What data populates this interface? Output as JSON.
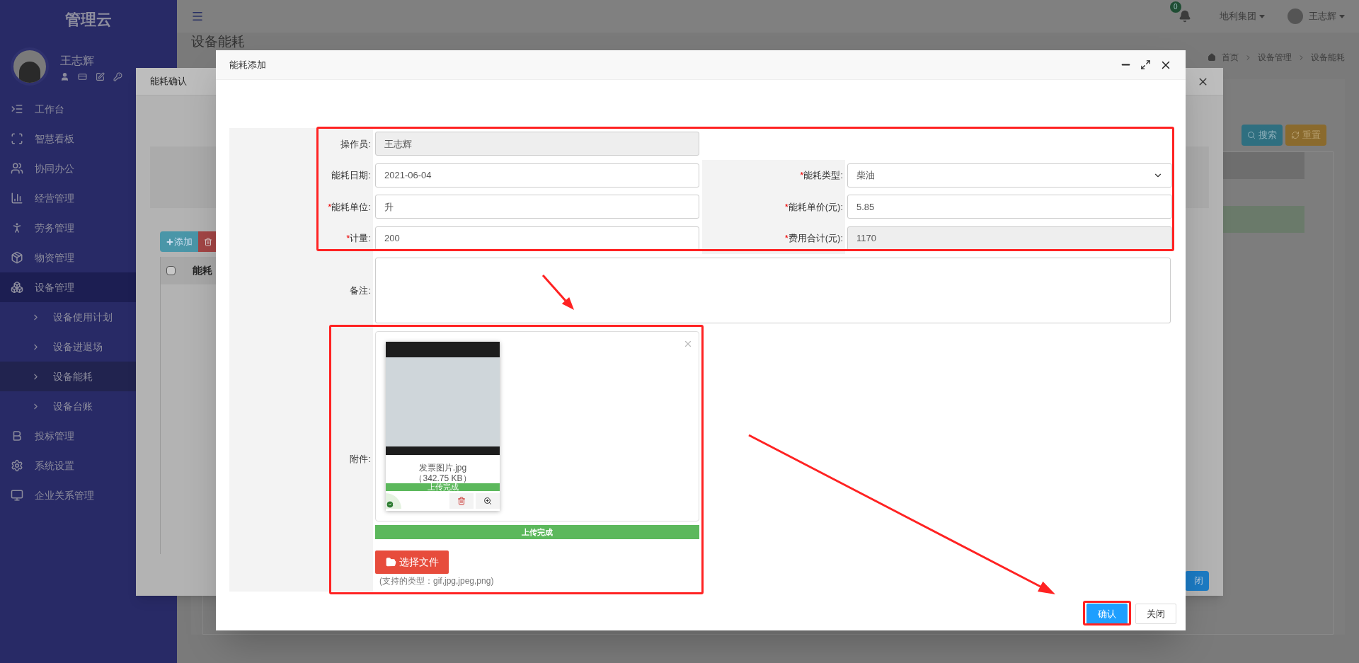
{
  "sidebar": {
    "title": "管理云",
    "user": "王志辉",
    "items": [
      {
        "label": "工作台"
      },
      {
        "label": "智慧看板"
      },
      {
        "label": "协同办公"
      },
      {
        "label": "经营管理"
      },
      {
        "label": "劳务管理"
      },
      {
        "label": "物资管理"
      },
      {
        "label": "设备管理",
        "expanded": true,
        "children": [
          {
            "label": "设备使用计划",
            "selected": false
          },
          {
            "label": "设备进退场",
            "selected": false
          },
          {
            "label": "设备能耗",
            "selected": true
          },
          {
            "label": "设备台账",
            "selected": false
          }
        ]
      },
      {
        "label": "投标管理"
      },
      {
        "label": "系统设置"
      },
      {
        "label": "企业关系管理"
      }
    ]
  },
  "top_bar": {
    "notification_count": "0",
    "organization": "地利集团",
    "user": "王志辉"
  },
  "page": {
    "title": "设备能耗",
    "breadcrumb": [
      "首页",
      "设备管理",
      "设备能耗"
    ],
    "search_button": "搜索",
    "reset_button": "重置"
  },
  "background_dialog": {
    "title": "能耗确认",
    "add_button": "添加",
    "table_header": "能耗",
    "select_all_checked": false,
    "footer_button": "闭"
  },
  "dialog": {
    "title": "能耗添加",
    "rows": [
      [
        {
          "label": "操作员:",
          "value": "王志辉",
          "readonly": true,
          "kind": "text"
        }
      ],
      [
        {
          "label": "能耗日期:",
          "value": "2021-06-04",
          "readonly": false,
          "kind": "text"
        },
        {
          "label": "能耗类型:",
          "required_mark": "*",
          "value": "柴油",
          "readonly": false,
          "kind": "select"
        }
      ],
      [
        {
          "label": "能耗单位:",
          "required_mark": "*",
          "value": "升",
          "readonly": false,
          "kind": "text"
        },
        {
          "label": "能耗单价(元):",
          "required_mark": "*",
          "value": "5.85",
          "readonly": false,
          "kind": "text"
        }
      ],
      [
        {
          "label": "计量:",
          "required_mark": "*",
          "value": "200",
          "readonly": false,
          "kind": "text"
        },
        {
          "label": "费用合计(元):",
          "required_mark": "*",
          "value": "1170",
          "readonly": true,
          "kind": "text"
        }
      ]
    ],
    "remarks": {
      "label": "备注:"
    },
    "attachment": {
      "label": "附件:",
      "files": [
        {
          "name": "发票图片.jpg",
          "size": "（342.75 KB）",
          "status": "上传完成",
          "level": 1,
          "uploaded": true
        }
      ],
      "progress": {
        "label": "上传完成",
        "level": 1
      },
      "choose_button": "选择文件",
      "hint": "(支持的类型：gif,jpg,jpeg,png)"
    },
    "buttons": [
      {
        "label": "确认",
        "kind": "primary"
      },
      {
        "label": "关闭",
        "kind": "default"
      }
    ]
  }
}
